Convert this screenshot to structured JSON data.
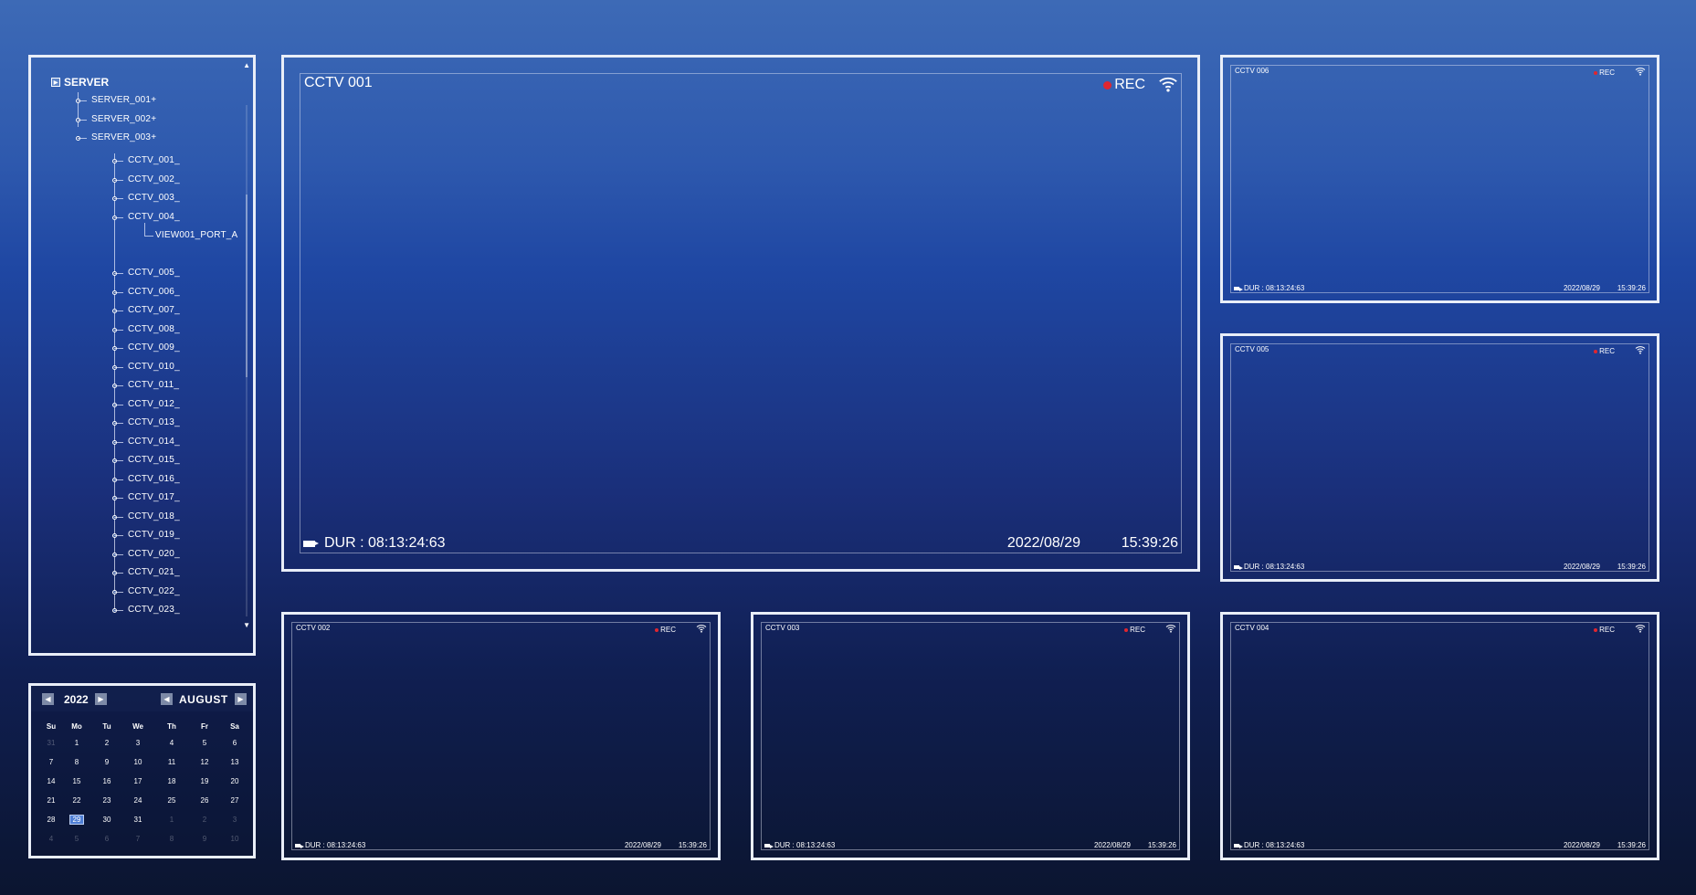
{
  "tree": {
    "root_label": "SERVER",
    "servers": [
      "SERVER_001+",
      "SERVER_002+",
      "SERVER_003+"
    ],
    "cctv_items": [
      "CCTV_001_",
      "CCTV_002_",
      "CCTV_003_",
      "CCTV_004_"
    ],
    "sub_item": "VIEW001_PORT_A",
    "cctv_items_more": [
      "CCTV_005_",
      "CCTV_006_",
      "CCTV_007_",
      "CCTV_008_",
      "CCTV_009_",
      "CCTV_010_",
      "CCTV_011_",
      "CCTV_012_",
      "CCTV_013_",
      "CCTV_014_",
      "CCTV_015_",
      "CCTV_016_",
      "CCTV_017_",
      "CCTV_018_",
      "CCTV_019_",
      "CCTV_020_",
      "CCTV_021_",
      "CCTV_022_",
      "CCTV_023_"
    ]
  },
  "calendar": {
    "year": "2022",
    "month": "AUGUST",
    "weekdays": [
      "Su",
      "Mo",
      "Tu",
      "We",
      "Th",
      "Fr",
      "Sa"
    ],
    "weeks": [
      [
        "31",
        "1",
        "2",
        "3",
        "4",
        "5",
        "6"
      ],
      [
        "7",
        "8",
        "9",
        "10",
        "11",
        "12",
        "13"
      ],
      [
        "14",
        "15",
        "16",
        "17",
        "18",
        "19",
        "20"
      ],
      [
        "21",
        "22",
        "23",
        "24",
        "25",
        "26",
        "27"
      ],
      [
        "28",
        "29",
        "30",
        "31",
        "1",
        "2",
        "3"
      ],
      [
        "4",
        "5",
        "6",
        "7",
        "8",
        "9",
        "10"
      ]
    ],
    "selected": "29"
  },
  "cameras": {
    "main": {
      "title": "CCTV 001",
      "rec": "REC",
      "dur": "DUR : 08:13:24:63",
      "date": "2022/08/29",
      "time": "15:39:26"
    },
    "cam006": {
      "title": "CCTV 006",
      "rec": "REC",
      "dur": "DUR : 08:13:24:63",
      "date": "2022/08/29",
      "time": "15:39:26"
    },
    "cam005": {
      "title": "CCTV 005",
      "rec": "REC",
      "dur": "DUR : 08:13:24:63",
      "date": "2022/08/29",
      "time": "15:39:26"
    },
    "cam002": {
      "title": "CCTV 002",
      "rec": "REC",
      "dur": "DUR : 08:13:24:63",
      "date": "2022/08/29",
      "time": "15:39:26"
    },
    "cam003": {
      "title": "CCTV 003",
      "rec": "REC",
      "dur": "DUR : 08:13:24:63",
      "date": "2022/08/29",
      "time": "15:39:26"
    },
    "cam004": {
      "title": "CCTV 004",
      "rec": "REC",
      "dur": "DUR : 08:13:24:63",
      "date": "2022/08/29",
      "time": "15:39:26"
    }
  },
  "colors": {
    "rec_dot": "#e0262f",
    "frame": "#e9eef8",
    "selected_day": "#4f7fd6"
  },
  "icons": [
    "play-box-icon",
    "record-dot-icon",
    "wifi-icon",
    "video-camera-icon",
    "arrow-left-icon",
    "arrow-right-icon",
    "scroll-up-icon",
    "scroll-down-icon"
  ]
}
